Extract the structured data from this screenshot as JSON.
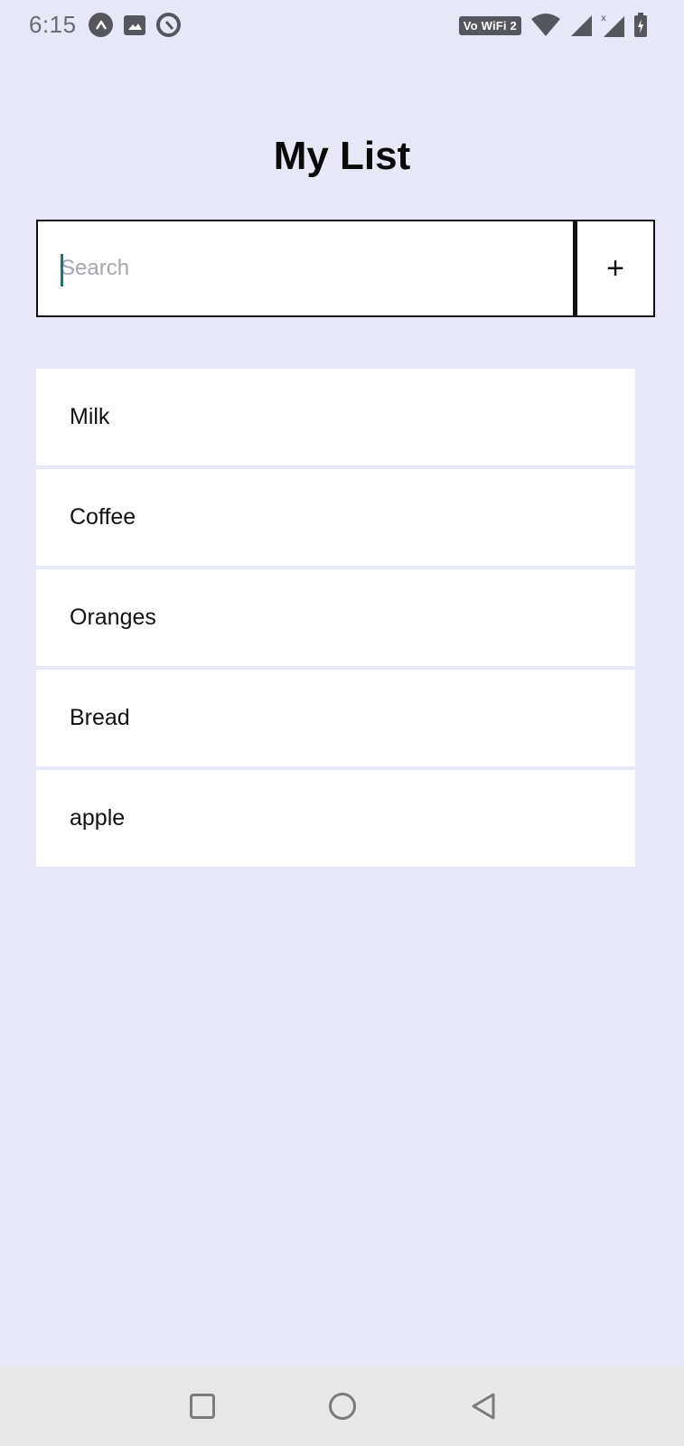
{
  "status_bar": {
    "time": "6:15",
    "network_badge": "Vo WiFi 2",
    "icons": [
      "app-icon",
      "gallery-icon",
      "sync-icon",
      "wifi-icon",
      "signal-icon",
      "signal-x-icon",
      "battery-charging-icon"
    ]
  },
  "header": {
    "title": "My List"
  },
  "search": {
    "placeholder": "Search",
    "value": "",
    "add_label": "+"
  },
  "list": {
    "items": [
      {
        "label": "Milk"
      },
      {
        "label": "Coffee"
      },
      {
        "label": "Oranges"
      },
      {
        "label": "Bread"
      },
      {
        "label": "apple"
      }
    ]
  },
  "nav_bar": {
    "icons": [
      "recents-icon",
      "home-icon",
      "back-icon"
    ]
  },
  "colors": {
    "background": "#e7e8f7",
    "card": "#ffffff",
    "cursor_accent": "#0e7c74",
    "nav_bar": "#e8e8e8"
  }
}
